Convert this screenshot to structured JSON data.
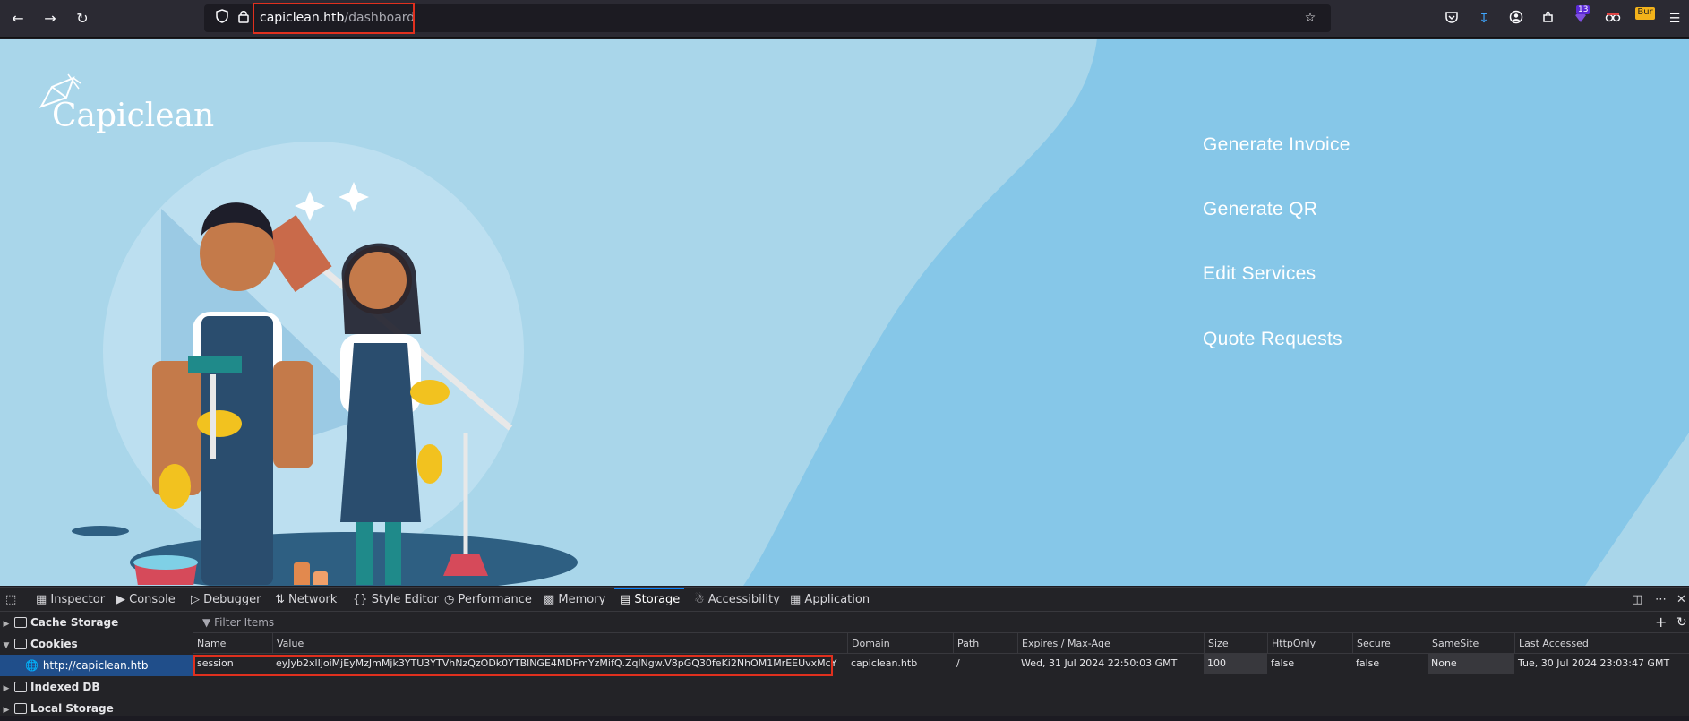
{
  "browser": {
    "url_host": "capiclean.htb",
    "url_path": "/dashboard",
    "extension_badge": "13",
    "burp_label": "Bur"
  },
  "page": {
    "logo_text": "Capiclean",
    "menu": [
      "Generate Invoice",
      "Generate QR",
      "Edit Services",
      "Quote Requests"
    ]
  },
  "devtools": {
    "tabs": [
      "Inspector",
      "Console",
      "Debugger",
      "Network",
      "Style Editor",
      "Performance",
      "Memory",
      "Storage",
      "Accessibility",
      "Application"
    ],
    "active_tab": "Storage",
    "sidebar": {
      "cache_storage": "Cache Storage",
      "cookies": "Cookies",
      "cookie_host": "http://capiclean.htb",
      "indexed_db": "Indexed DB",
      "local_storage": "Local Storage"
    },
    "filter_placeholder": "Filter Items",
    "columns": [
      "Name",
      "Value",
      "Domain",
      "Path",
      "Expires / Max-Age",
      "Size",
      "HttpOnly",
      "Secure",
      "SameSite",
      "Last Accessed"
    ],
    "cookie_row": {
      "name": "session",
      "value": "eyJyb2xlIjoiMjEyMzJmMjk3YTU3YTVhNzQzODk0YTBlNGE4MDFmYzMifQ.ZqlNgw.V8pGQ30feKi2NhOM1MrEEUvxMcY",
      "domain": "capiclean.htb",
      "path": "/",
      "expires": "Wed, 31 Jul 2024 22:50:03 GMT",
      "size": "100",
      "httponly": "false",
      "secure": "false",
      "samesite": "None",
      "last_accessed": "Tue, 30 Jul 2024 23:03:47 GMT"
    }
  },
  "colors": {
    "highlight": "#e0301e",
    "accent": "#0a84ff"
  }
}
